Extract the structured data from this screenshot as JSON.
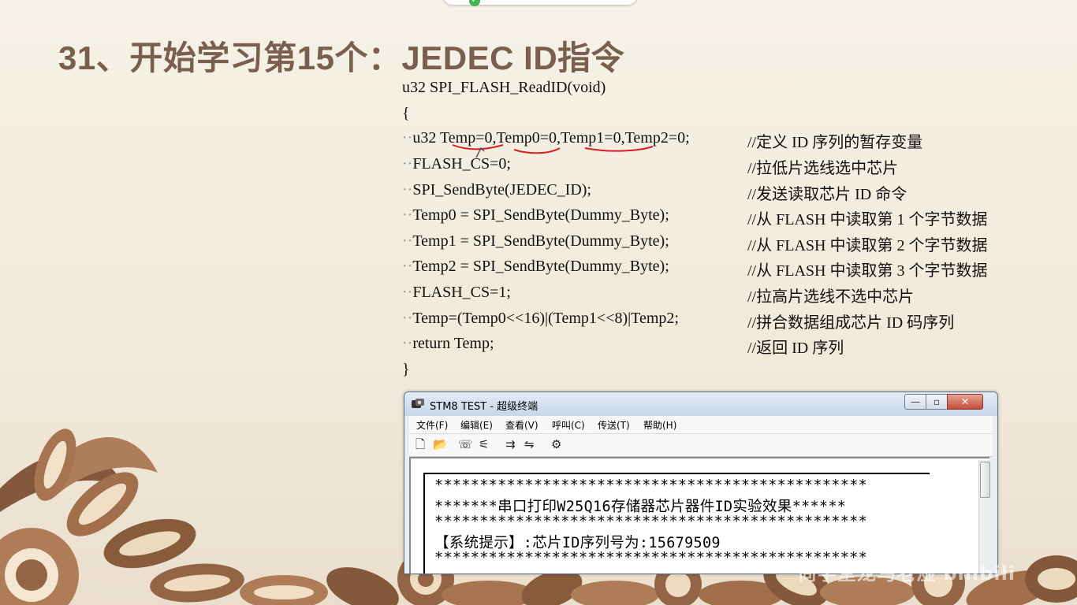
{
  "slide": {
    "title": "31、开始学习第15个：JEDEC ID指令"
  },
  "code": {
    "header": "u32 SPI_FLASH_ReadID(void)",
    "open_brace": "{",
    "close_brace": "}",
    "lines": [
      {
        "code": "u32 Temp=0,Temp0=0,Temp1=0,Temp2=0;",
        "comment": "//定义 ID 序列的暂存变量"
      },
      {
        "code": "FLASH_CS=0;",
        "comment": "//拉低片选线选中芯片"
      },
      {
        "code": "SPI_SendByte(JEDEC_ID);",
        "comment": "//发送读取芯片 ID 命令"
      },
      {
        "code": "Temp0 = SPI_SendByte(Dummy_Byte);",
        "comment": "//从 FLASH 中读取第 1 个字节数据"
      },
      {
        "code": "Temp1 = SPI_SendByte(Dummy_Byte);",
        "comment": "//从 FLASH 中读取第 2 个字节数据"
      },
      {
        "code": "Temp2 = SPI_SendByte(Dummy_Byte);",
        "comment": "//从 FLASH 中读取第 3 个字节数据"
      },
      {
        "code": "FLASH_CS=1;",
        "comment": "//拉高片选线不选中芯片"
      },
      {
        "code": "Temp=(Temp0<<16)|(Temp1<<8)|Temp2;",
        "comment": "//拼合数据组成芯片 ID 码序列"
      },
      {
        "code": "return Temp;",
        "comment": "//返回 ID 序列"
      }
    ],
    "annotation_color": "#d81e1e"
  },
  "terminal": {
    "window_title": "STM8 TEST - 超级终端",
    "minimize": "—",
    "maximize": "▫",
    "close": "✕",
    "menu": [
      "文件(F)",
      "编辑(E)",
      "查看(V)",
      "呼叫(C)",
      "传送(T)",
      "帮助(H)"
    ],
    "toolbar": [
      {
        "icon": "new-file-icon",
        "glyph": "🗋"
      },
      {
        "icon": "open-folder-icon",
        "glyph": "📂"
      },
      {
        "icon": "phone-icon",
        "glyph": "☏"
      },
      {
        "icon": "disconnect-icon",
        "glyph": "⚟"
      },
      {
        "icon": "send-file-icon",
        "glyph": "⇉"
      },
      {
        "icon": "receive-file-icon",
        "glyph": "⇋"
      },
      {
        "icon": "properties-icon",
        "glyph": "⚙"
      }
    ],
    "lines": [
      "************************************************",
      "*******串口打印W25Q16存储器芯片器件ID实验效果******",
      "************************************************",
      "【系统提示】:芯片ID序列号为:15679509",
      "************************************************"
    ]
  },
  "watermark": "尚学堂龙马老湿 bilibili",
  "colors": {
    "title": "#7a5f4f",
    "background": "#f3ede1",
    "decor_brown": "#8b5a3a"
  }
}
